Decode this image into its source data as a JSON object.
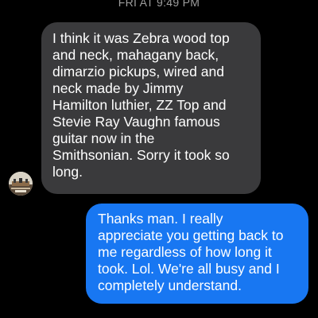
{
  "conversation": {
    "timestamp": "FRI AT 9:49 PM",
    "messages": [
      {
        "direction": "incoming",
        "text": "I think it was Zebra wood top\nand neck, mahagany back,\ndimarzio pickups, wired and\nneck made by Jimmy\nHamilton luthier, ZZ Top and\nStevie Ray Vaughn famous\nguitar now in the\nSmithsonian. Sorry it took so\nlong."
      },
      {
        "direction": "outgoing",
        "text": "Thanks man. I really\nappreciate you getting back to\nme regardless of how long it\ntook. Lol. We're all busy and I\ncompletely understand."
      }
    ],
    "avatar_icon": "contact-avatar",
    "colors": {
      "background": "#000000",
      "incoming_bubble": "#3a3a3c",
      "outgoing_bubble": "#1877f2",
      "timestamp_text": "#9e9e9e"
    }
  }
}
